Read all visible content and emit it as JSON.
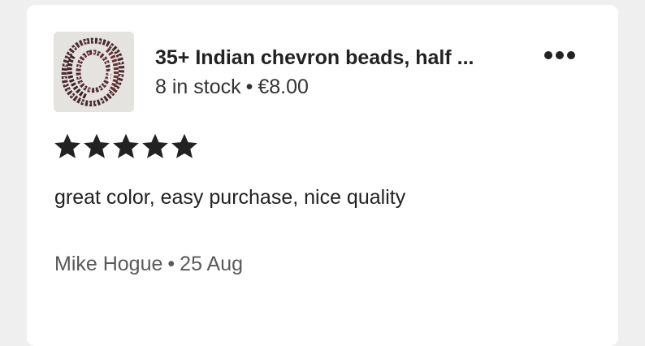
{
  "listing": {
    "title": "35+ Indian chevron beads, half ...",
    "stock": "8 in stock",
    "separator": "•",
    "price": "€8.00",
    "thumbnail_icon": "bead-necklace-thumbnail"
  },
  "menu": {
    "icon": "more-options-icon"
  },
  "review": {
    "rating": 5,
    "rating_max": 5,
    "text": "great color, easy purchase, nice quality",
    "author": "Mike Hogue",
    "separator": "•",
    "date": "25 Aug"
  },
  "colors": {
    "page_bg": "#efefef",
    "card_bg": "#ffffff",
    "text_primary": "#222222",
    "text_secondary": "#595959",
    "star": "#222222"
  }
}
